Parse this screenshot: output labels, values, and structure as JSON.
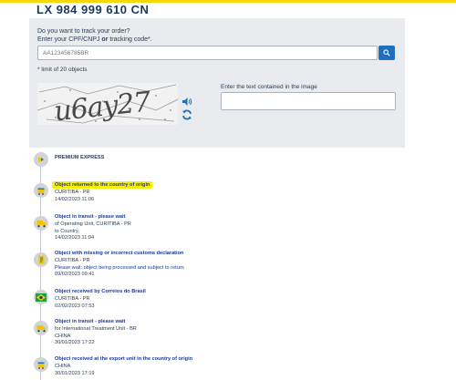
{
  "header": {
    "tracking_code": "LX 984 999 610 CN"
  },
  "form": {
    "prompt_line1": "Do you want to track your order?",
    "prompt_line2_pre": "Enter your CPF/CNPJ ",
    "prompt_line2_or": "or",
    "prompt_line2_post": " tracking code*.",
    "input_placeholder": "AA123456785BR",
    "limit_note": "* limit of 20 objects",
    "captcha_label": "Enter the text contained in the image",
    "captcha_text": "u6ay27",
    "search_icon": "search-icon",
    "audio_icon": "speaker-icon",
    "refresh_icon": "refresh-icon"
  },
  "timeline": {
    "carrier": "PREMIUM EXPRESS",
    "events": [
      {
        "status": "Object returned to the country of origin",
        "lines": [
          "CURITIBA - PR"
        ],
        "note": "",
        "datetime": "14/02/2023 11:06",
        "icon": "package-icon"
      },
      {
        "status": "Object in transit - please wait",
        "lines": [
          "of Operating Unit, CURITIBA - PR",
          "to Country,"
        ],
        "note": "",
        "datetime": "14/02/2023 11:04",
        "icon": "truck-icon"
      },
      {
        "status": "Object with missing or incorrect customs declaration",
        "lines": [
          "CURITIBA - PR"
        ],
        "note": "Please wait: object being processed and subject to return",
        "datetime": "09/02/2023 09:41",
        "icon": "document-icon"
      },
      {
        "status": "Object received by Correios do Brasil",
        "lines": [
          "CURITIBA - PR"
        ],
        "note": "",
        "datetime": "02/02/2023 07:53",
        "icon": "brazil-flag-icon"
      },
      {
        "status": "Object in transit - please wait",
        "lines": [
          "for International Treatment Unit - BR",
          "CHINA"
        ],
        "note": "",
        "datetime": "30/01/2023 17:22",
        "icon": "truck-icon"
      },
      {
        "status": "Object received at the export unit in the country of origin",
        "lines": [
          "CHINA"
        ],
        "note": "",
        "datetime": "30/01/2023 17:19",
        "icon": "package-icon"
      }
    ]
  },
  "colors": {
    "accent_blue": "#1f6fbf",
    "highlight": "#f7f000",
    "icon_yellow": "#f5c400",
    "panel": "#e9ebee"
  }
}
